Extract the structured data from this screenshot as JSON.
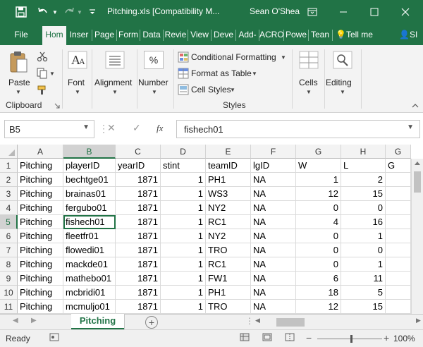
{
  "titlebar": {
    "title": "Pitching.xls  [Compatibility M...",
    "user": "Sean O'Shea",
    "save_icon": "save-icon",
    "undo_icon": "undo-icon",
    "redo_icon": "redo-icon",
    "customize_icon": "customize-qat-icon",
    "ribbon_display_icon": "ribbon-display-options-icon",
    "minimize_icon": "minimize-icon",
    "maximize_icon": "maximize-icon",
    "close_icon": "close-icon"
  },
  "tabs": [
    "File",
    "Hom",
    "Inser",
    "Page",
    "Form",
    "Data",
    "Revie",
    "View",
    "Deve",
    "Add-",
    "ACRO",
    "Powe",
    "Tean"
  ],
  "active_tab": "Hom",
  "tell_me": "Tell me",
  "share": "SI",
  "ribbon": {
    "clipboard": {
      "paste": "Paste",
      "label": "Clipboard"
    },
    "font": {
      "label": "Font"
    },
    "alignment": {
      "label": "Alignment"
    },
    "number": {
      "label": "Number",
      "symbol": "%"
    },
    "styles": {
      "conditional": "Conditional Formatting",
      "format_table": "Format as Table",
      "cell_styles": "Cell Styles",
      "label": "Styles"
    },
    "cells": {
      "label": "Cells"
    },
    "editing": {
      "label": "Editing"
    }
  },
  "formula_bar": {
    "name_box": "B5",
    "fx": "fx",
    "content": "fishech01"
  },
  "grid": {
    "columns": [
      "A",
      "B",
      "C",
      "D",
      "E",
      "F",
      "G",
      "H",
      "G"
    ],
    "selected_column": "B",
    "selected_row": "5",
    "rows": [
      {
        "n": "1",
        "cells": [
          "Pitching",
          "playerID",
          "yearID",
          "stint",
          "teamID",
          "lgID",
          "W",
          "L",
          "G"
        ]
      },
      {
        "n": "2",
        "cells": [
          "Pitching",
          "bechtge01",
          "1871",
          "1",
          "PH1",
          "NA",
          "1",
          "2",
          ""
        ]
      },
      {
        "n": "3",
        "cells": [
          "Pitching",
          "brainas01",
          "1871",
          "1",
          "WS3",
          "NA",
          "12",
          "15",
          ""
        ]
      },
      {
        "n": "4",
        "cells": [
          "Pitching",
          "fergubo01",
          "1871",
          "1",
          "NY2",
          "NA",
          "0",
          "0",
          ""
        ]
      },
      {
        "n": "5",
        "cells": [
          "Pitching",
          "fishech01",
          "1871",
          "1",
          "RC1",
          "NA",
          "4",
          "16",
          ""
        ]
      },
      {
        "n": "6",
        "cells": [
          "Pitching",
          "fleetfr01",
          "1871",
          "1",
          "NY2",
          "NA",
          "0",
          "1",
          ""
        ]
      },
      {
        "n": "7",
        "cells": [
          "Pitching",
          "flowedi01",
          "1871",
          "1",
          "TRO",
          "NA",
          "0",
          "0",
          ""
        ]
      },
      {
        "n": "8",
        "cells": [
          "Pitching",
          "mackde01",
          "1871",
          "1",
          "RC1",
          "NA",
          "0",
          "1",
          ""
        ]
      },
      {
        "n": "9",
        "cells": [
          "Pitching",
          "mathebo01",
          "1871",
          "1",
          "FW1",
          "NA",
          "6",
          "11",
          ""
        ]
      },
      {
        "n": "10",
        "cells": [
          "Pitching",
          "mcbridi01",
          "1871",
          "1",
          "PH1",
          "NA",
          "18",
          "5",
          ""
        ]
      },
      {
        "n": "11",
        "cells": [
          "Pitching",
          "mcmuljo01",
          "1871",
          "1",
          "TRO",
          "NA",
          "12",
          "15",
          ""
        ]
      }
    ]
  },
  "sheet_tabs": [
    "Pitching"
  ],
  "status": {
    "ready": "Ready",
    "zoom": "100%"
  },
  "colors": {
    "accent": "#217346",
    "ribbon_bg": "#f3f3f3"
  }
}
